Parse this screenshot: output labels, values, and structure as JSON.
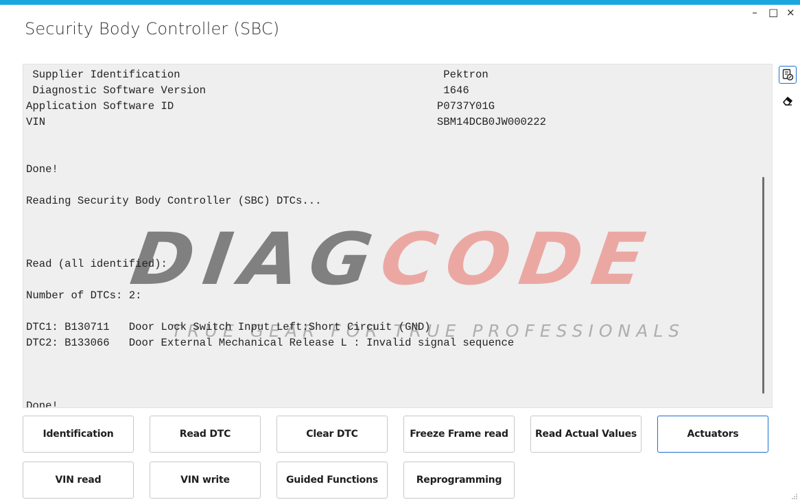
{
  "window": {
    "title": "Security Body Controller (SBC)",
    "controls": {
      "minimize": "–",
      "maximize": "□",
      "close": "×"
    },
    "accent_color": "#1aa7df"
  },
  "output": {
    "lines": [
      " Supplier Identification                                         Pektron",
      " Diagnostic Software Version                                     1646",
      "Application Software ID                                         P0737Y01G",
      "VIN                                                             SBM14DCB0JW000222",
      "",
      "",
      "Done!",
      "",
      "Reading Security Body Controller (SBC) DTCs...",
      "",
      "",
      "",
      "Read (all identified):",
      "",
      "Number of DTCs: 2:",
      "",
      "DTC1: B130711   Door Lock Switch Input Left:Short Circuit (GND)",
      "DTC2: B133066   Door External Mechanical Release L : Invalid signal sequence",
      "",
      "",
      "",
      "Done!"
    ]
  },
  "watermark": {
    "logo_part1": "DIAG",
    "logo_part2": "CODE",
    "tagline": "TRUE GEAR FOR TRUE PROFESSIONALS"
  },
  "side_tools": [
    {
      "icon": "copy-icon"
    },
    {
      "icon": "eraser-icon"
    }
  ],
  "buttons": {
    "identification": "Identification",
    "read_dtc": "Read DTC",
    "clear_dtc": "Clear DTC",
    "freeze_frame": "Freeze Frame read",
    "read_actual_values": "Read Actual Values",
    "actuators": "Actuators",
    "vin_read": "VIN read",
    "vin_write": "VIN write",
    "guided_functions": "Guided Functions",
    "reprogramming": "Reprogramming"
  },
  "colors": {
    "panel_bg": "#efefef",
    "active_border": "#1a6fd1"
  }
}
